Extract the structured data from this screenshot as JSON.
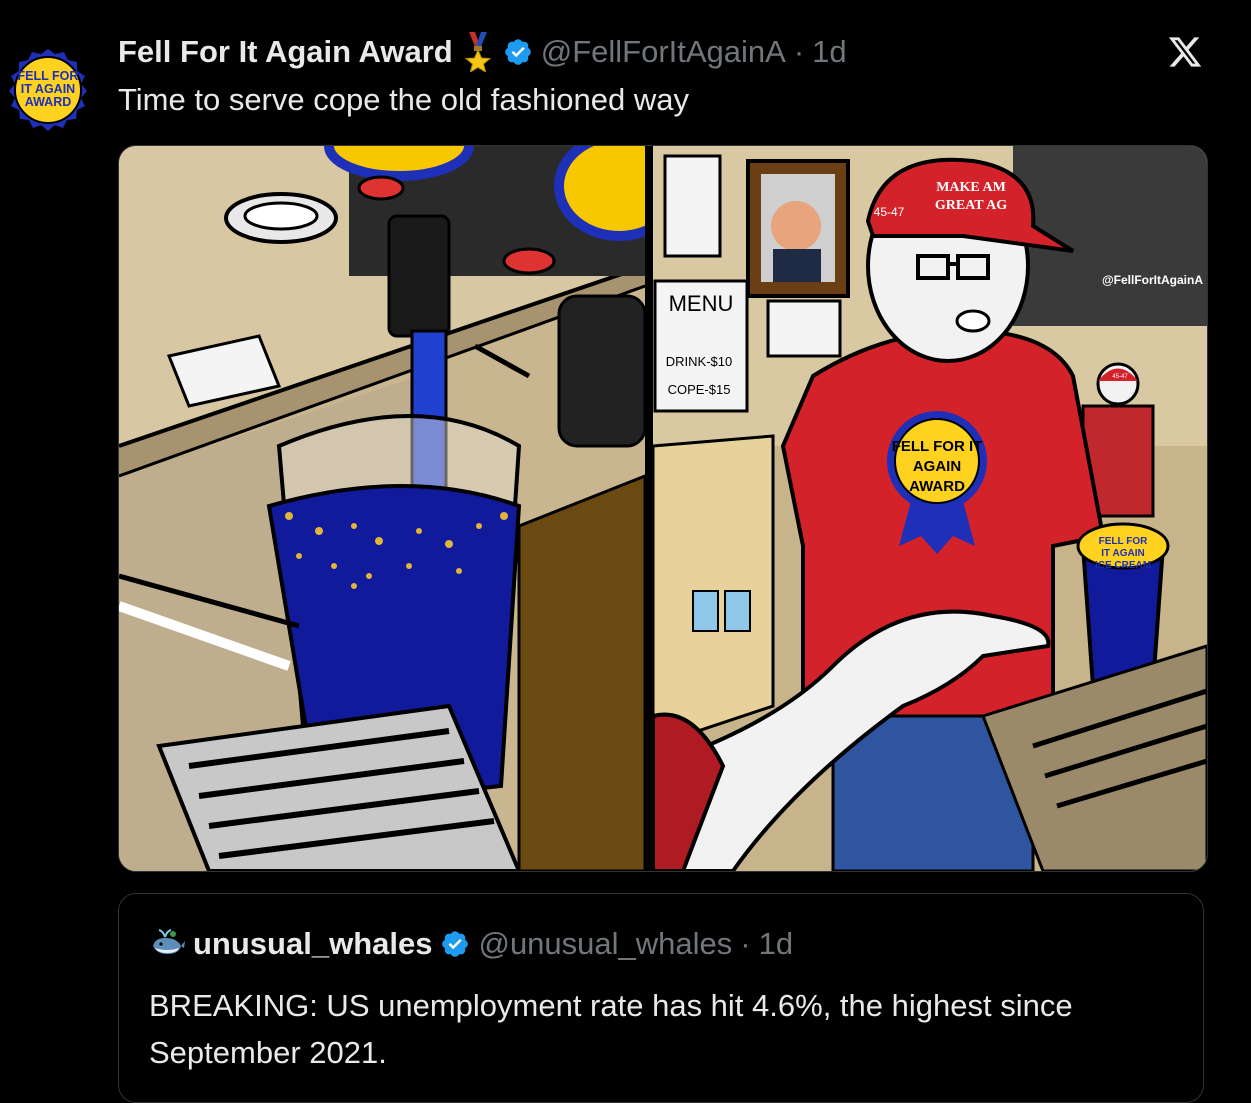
{
  "tweet": {
    "avatar_text": [
      "FELL FOR",
      "IT AGAIN",
      "AWARD"
    ],
    "display_name": "Fell For It Again Award",
    "handle": "@FellForItAgainA",
    "separator": "·",
    "time": "1d",
    "text": "Time to serve cope the old fashioned way"
  },
  "media": {
    "watermark": "@FellForItAgainA",
    "menu": {
      "title": "MENU",
      "items": [
        "DRINK-$10",
        "COPE-$15"
      ]
    },
    "cap_text": [
      "MAKE AM",
      "GREAT AG"
    ],
    "cap_number": "45-47",
    "shirt_badge": [
      "FELL FOR IT",
      "AGAIN",
      "AWARD"
    ],
    "cup_label": [
      "FELL FOR",
      "IT AGAIN",
      "ICE CREAM"
    ],
    "small_cap_number": "45-47"
  },
  "quote": {
    "display_name": "unusual_whales",
    "handle": "@unusual_whales",
    "separator": "·",
    "time": "1d",
    "text": "BREAKING: US unemployment rate has hit 4.6%, the highest since September 2021."
  },
  "colors": {
    "verified": "#1d9bf0",
    "secondary_text": "#71767b",
    "badge_yellow": "#ffd21f",
    "badge_blue": "#1e2fb8"
  }
}
